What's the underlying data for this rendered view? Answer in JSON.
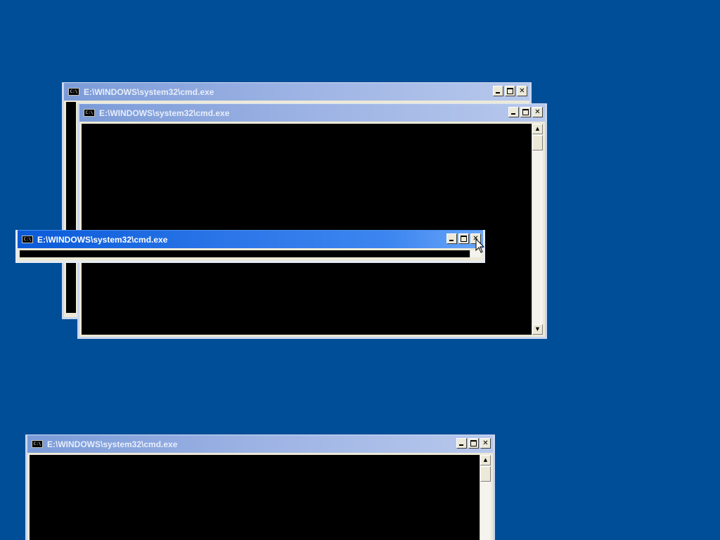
{
  "desktop": {
    "background_color": "#004e98"
  },
  "windows": [
    {
      "id": "cmd-window-back",
      "title": "E:\\WINDOWS\\system32\\cmd.exe",
      "icon": "cmd-icon",
      "active": false
    },
    {
      "id": "cmd-window-middle",
      "title": "E:\\WINDOWS\\system32\\cmd.exe",
      "icon": "cmd-icon",
      "active": false
    },
    {
      "id": "cmd-window-front",
      "title": "E:\\WINDOWS\\system32\\cmd.exe",
      "icon": "cmd-icon",
      "active": true
    },
    {
      "id": "cmd-window-bottom",
      "title": "E:\\WINDOWS\\system32\\cmd.exe",
      "icon": "cmd-icon",
      "active": false
    }
  ],
  "icons": {
    "cmd_icon_text": "C:\\",
    "minimize": "minimize-icon",
    "maximize": "maximize-icon",
    "close": "close-icon",
    "scroll_up": "scroll-up-arrow-icon",
    "scroll_down": "scroll-down-arrow-icon",
    "cursor": "mouse-pointer-icon"
  },
  "glyphs": {
    "close": "✕",
    "up": "▲",
    "down": "▼"
  },
  "colors": {
    "active_title": "#0a5ad8",
    "inactive_title": "#9db3e4",
    "console_bg": "#000000"
  }
}
